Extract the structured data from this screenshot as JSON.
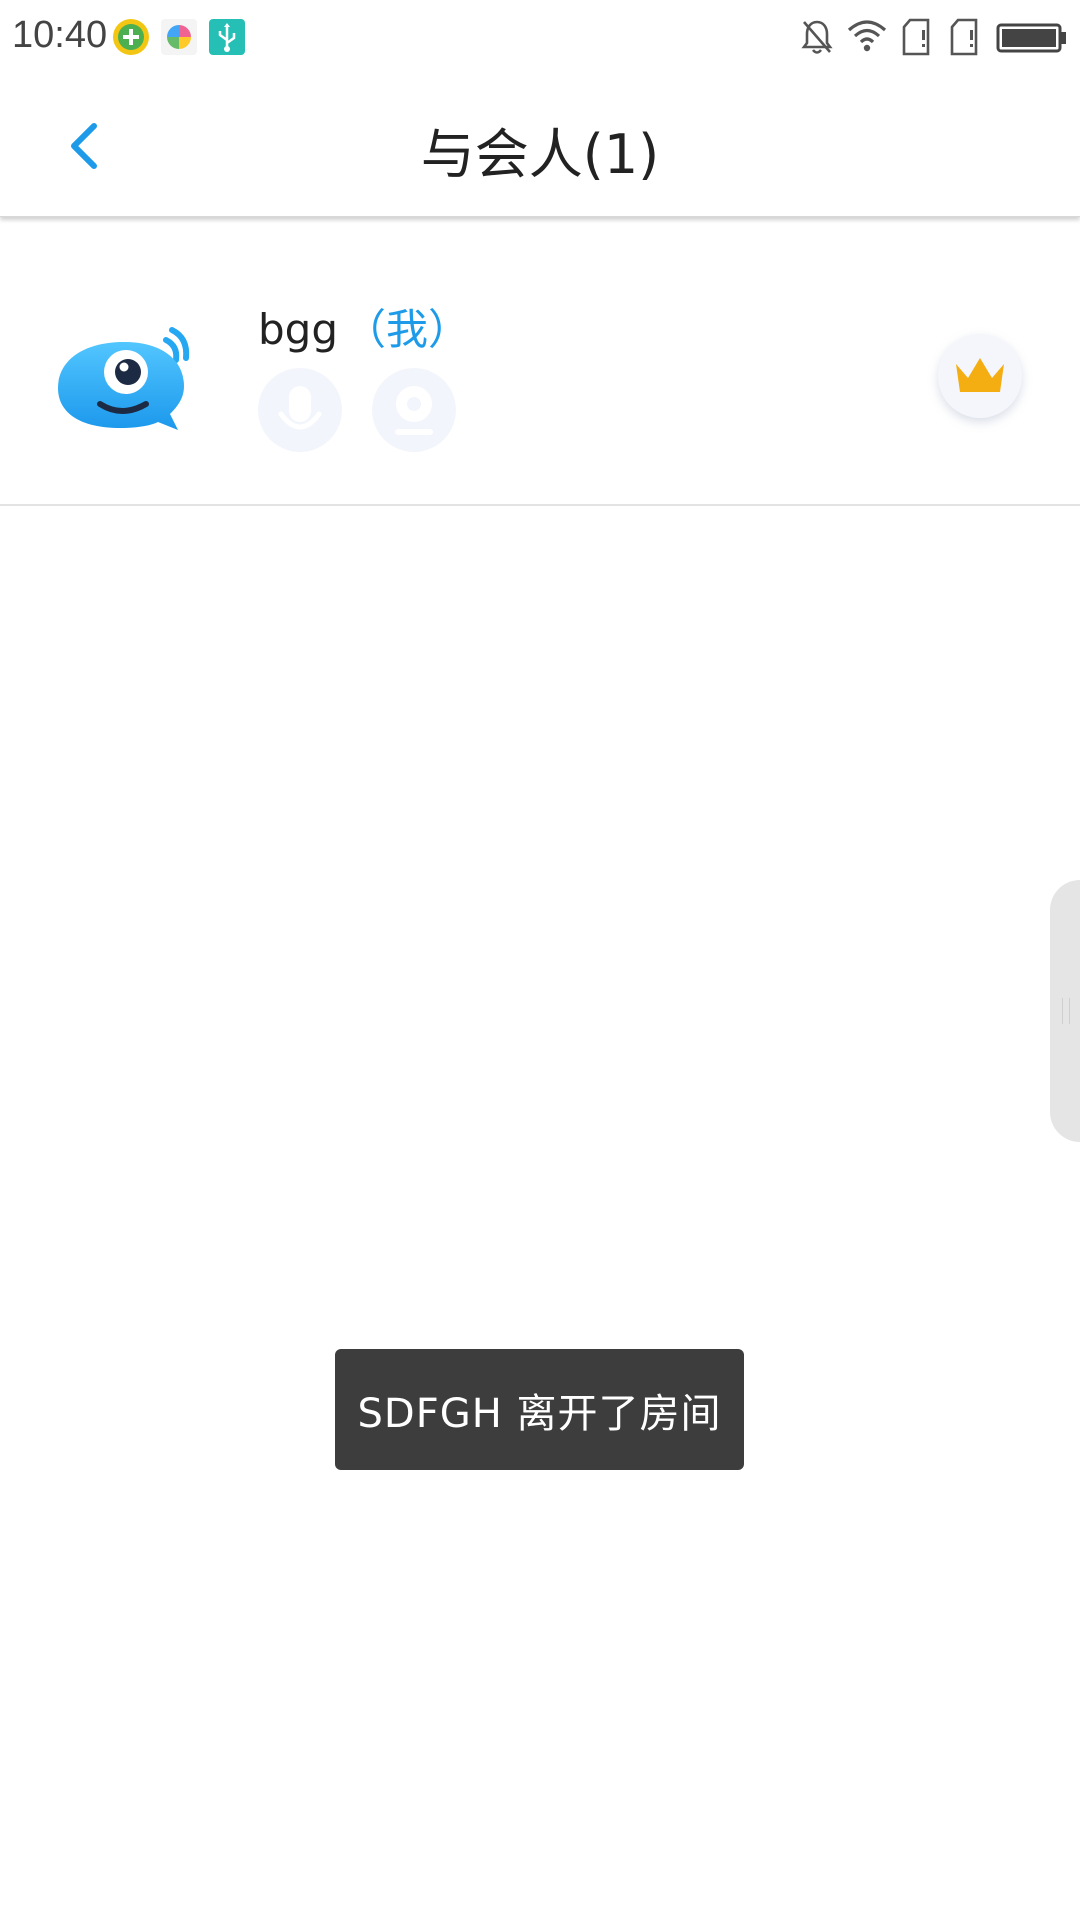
{
  "status_bar": {
    "time": "10:40",
    "icons": [
      "plus-circle-icon",
      "pinwheel-icon",
      "usb-icon",
      "bell-off-icon",
      "wifi-icon",
      "sim-card-icon",
      "sim-card-icon",
      "battery-icon"
    ]
  },
  "header": {
    "title": "与会人(1)",
    "back_icon": "chevron-left-icon",
    "accent_color": "#1E9BE8"
  },
  "participants": [
    {
      "name": "bgg",
      "tag": "（我）",
      "avatar_icon": "mascot-avatar-icon",
      "mic_icon": "microphone-icon",
      "camera_icon": "camera-icon",
      "role_icon": "crown-icon"
    }
  ],
  "toast": {
    "message": "SDFGH 离开了房间"
  },
  "colors": {
    "tag_blue": "#1E9BE8",
    "crown_gold": "#F4AE12",
    "toast_bg": "#3D3D3D"
  }
}
